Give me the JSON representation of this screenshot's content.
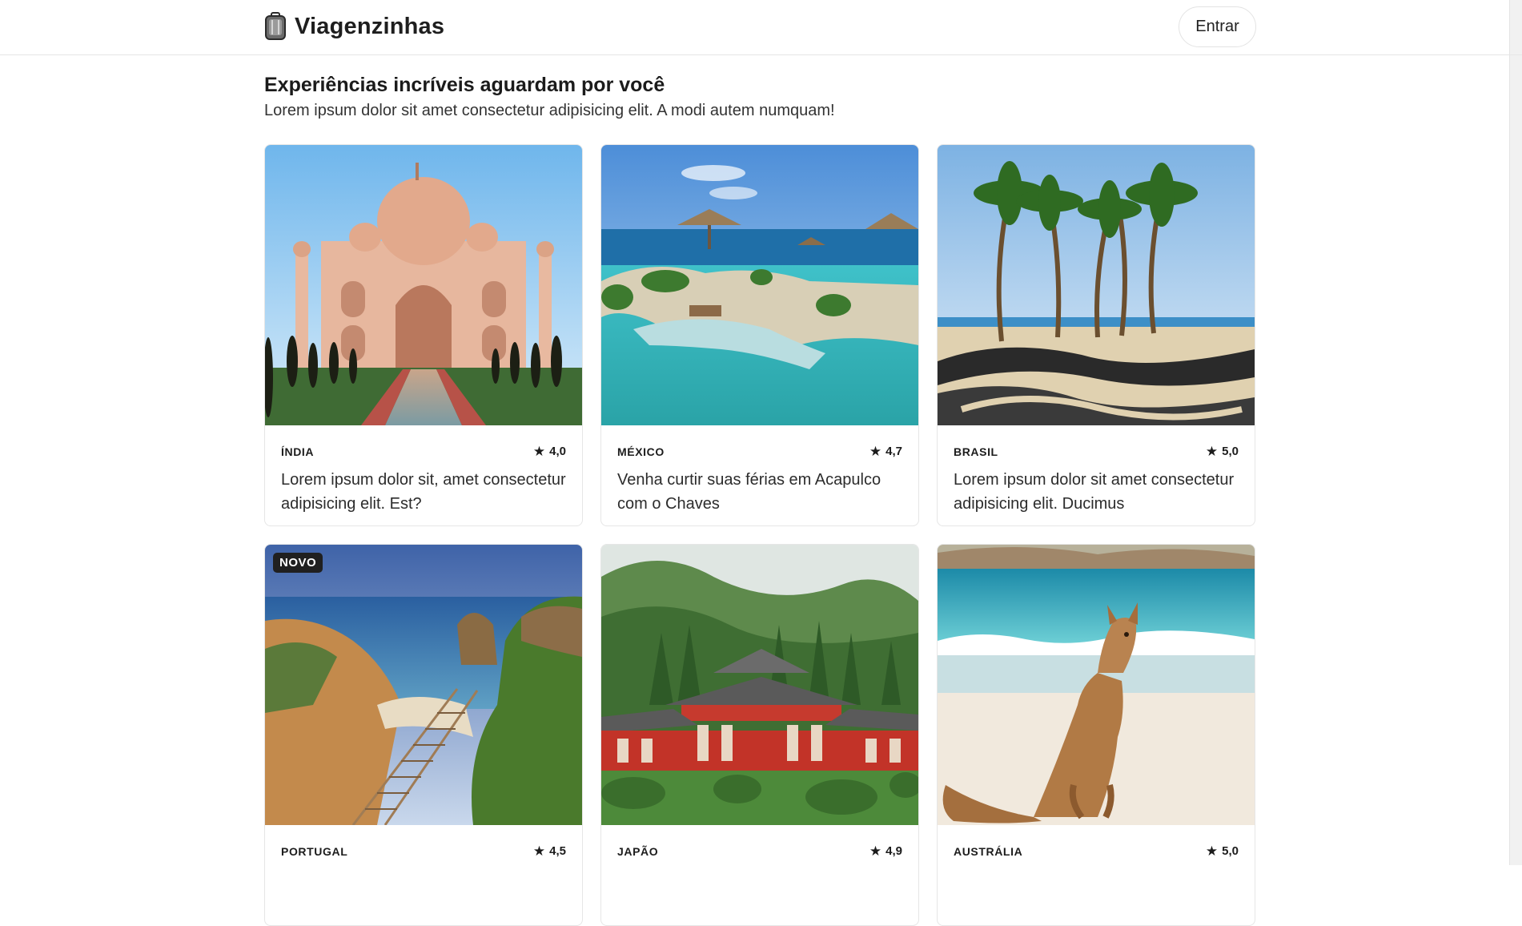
{
  "header": {
    "brand_icon": "luggage-icon",
    "brand_name": "Viagenzinhas",
    "login_label": "Entrar"
  },
  "hero": {
    "title": "Experiências incríveis aguardam por você",
    "subtitle": "Lorem ipsum dolor sit amet consectetur adipisicing elit. A modi autem numquam!"
  },
  "cards": [
    {
      "country": "ÍNDIA",
      "rating": "4,0",
      "description": "Lorem ipsum dolor sit, amet consectetur adipisicing elit. Est?",
      "badge": "",
      "image": "taj-mahal"
    },
    {
      "country": "MÉXICO",
      "rating": "4,7",
      "description": "Venha curtir suas férias em Acapulco com o Chaves",
      "badge": "",
      "image": "acapulco-pools"
    },
    {
      "country": "BRASIL",
      "rating": "5,0",
      "description": "Lorem ipsum dolor sit amet consectetur adipisicing elit. Ducimus",
      "badge": "",
      "image": "copacabana-palms"
    },
    {
      "country": "PORTUGAL",
      "rating": "4,5",
      "description": "",
      "badge": "NOVO",
      "image": "algarve-cliffs"
    },
    {
      "country": "JAPÃO",
      "rating": "4,9",
      "description": "",
      "badge": "",
      "image": "japanese-temple"
    },
    {
      "country": "AUSTRÁLIA",
      "rating": "5,0",
      "description": "",
      "badge": "",
      "image": "kangaroo-beach"
    }
  ],
  "icons": {
    "star": "star-icon"
  },
  "colors": {
    "accent": "#1f1f1f",
    "border": "#e6e6e6",
    "badge_bg": "#202020"
  }
}
